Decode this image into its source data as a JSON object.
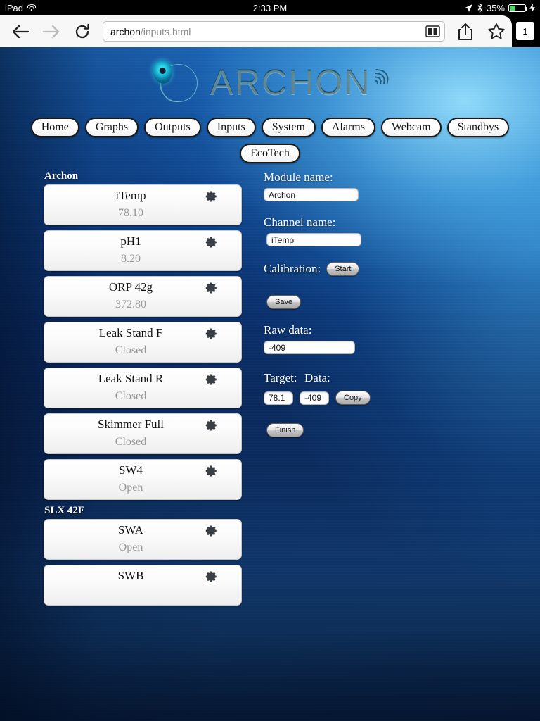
{
  "statusbar": {
    "device": "iPad",
    "wifi_icon": "wifi-icon",
    "time": "2:33 PM",
    "location_icon": "location-arrow-icon",
    "bluetooth_icon": "bluetooth-icon",
    "battery_percent": "35%",
    "battery_icon": "battery-icon",
    "charging_icon": "lightning-bolt-icon"
  },
  "toolbar": {
    "back_icon": "back-arrow-icon",
    "forward_icon": "forward-arrow-icon",
    "reload_icon": "reload-icon",
    "url_host": "archon",
    "url_path": "/inputs.html",
    "reader_icon": "reader-book-icon",
    "share_icon": "share-icon",
    "bookmark_icon": "bookmark-star-icon",
    "tab_count": "1"
  },
  "logo": {
    "wordmark": "ARCHON",
    "mark_icon": "archon-drop-icon",
    "waves_icon": "signal-waves-icon"
  },
  "nav": {
    "row1": [
      {
        "label": "Home"
      },
      {
        "label": "Graphs"
      },
      {
        "label": "Outputs"
      },
      {
        "label": "Inputs"
      },
      {
        "label": "System"
      },
      {
        "label": "Alarms"
      },
      {
        "label": "Webcam"
      },
      {
        "label": "Standbys"
      }
    ],
    "row2": [
      {
        "label": "EcoTech"
      }
    ]
  },
  "channel_groups": [
    {
      "title": "Archon",
      "items": [
        {
          "name": "iTemp",
          "value": "78.10",
          "align": "center"
        },
        {
          "name": "pH1",
          "value": "8.20",
          "align": "center"
        },
        {
          "name": "ORP 42g",
          "value": "372.80",
          "align": "center"
        },
        {
          "name": "Leak Stand F",
          "value": "Closed",
          "align": "center"
        },
        {
          "name": "Leak Stand R",
          "value": "Closed",
          "align": "center"
        },
        {
          "name": "Skimmer Full",
          "value": "Closed",
          "align": "center"
        },
        {
          "name": "SW4",
          "value": "Open",
          "align": "center"
        }
      ]
    },
    {
      "title": "SLX 42F",
      "items": [
        {
          "name": "SWA",
          "value": "Open",
          "align": "center"
        },
        {
          "name": "SWB",
          "value": "",
          "align": "center"
        }
      ]
    }
  ],
  "form": {
    "module_label": "Module name:",
    "module_value": "Archon",
    "channel_label": "Channel name:",
    "channel_value": "iTemp",
    "calibration_label": "Calibration:",
    "start_button": "Start",
    "save_button": "Save",
    "raw_data_label": "Raw data:",
    "raw_data_value": "-409",
    "target_label": "Target:",
    "data_label": "Data:",
    "target_value": "78.1",
    "data_value": "-409",
    "copy_button": "Copy",
    "finish_button": "Finish"
  },
  "colors": {
    "page_bg_dark": "#0a2a5e",
    "page_bg_light": "#5ac3fa",
    "pill_bg": "#ffffff",
    "pill_border": "#1a1a1a",
    "value_text": "#9a9a9a",
    "battery_green": "#4cd964"
  }
}
